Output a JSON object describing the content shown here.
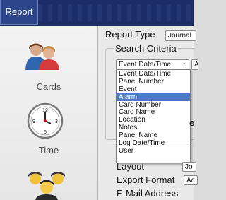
{
  "header": {
    "tab_label": "Report"
  },
  "sidebar": {
    "items": [
      {
        "label": "Cards",
        "icon": "people-icon"
      },
      {
        "label": "Time",
        "icon": "clock-icon"
      },
      {
        "label": "",
        "icon": "group-icon"
      }
    ]
  },
  "main": {
    "report_type_label": "Report Type",
    "report_type_value": "Journal",
    "search_criteria_label": "Search Criteria",
    "field_select_value": "Event Date/Time",
    "field_select_arrow": "↕",
    "right_field_value": "A",
    "partial_label_e": "e",
    "layout_label": "Layout",
    "layout_value": "Jo",
    "export_format_label": "Export Format",
    "export_format_value": "Ac",
    "email_label": "E-Mail Address"
  },
  "dropdown": {
    "options": [
      "Event Date/Time",
      "Panel Number",
      "Event",
      "Alarm",
      "Card Number",
      "Card Name",
      "Location",
      "Notes",
      "Panel Name",
      "Log Date/Time",
      "User"
    ],
    "selected": "Alarm"
  }
}
